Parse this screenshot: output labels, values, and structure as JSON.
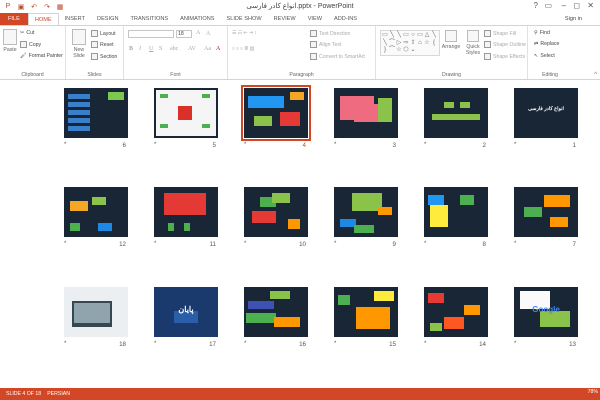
{
  "app": {
    "title": "انواع کادر فارسی.pptx - PowerPoint"
  },
  "quick_access": [
    "save-icon",
    "undo-icon",
    "redo-icon",
    "slideshow-icon"
  ],
  "window_controls": [
    "?",
    "▭",
    "–",
    "◻",
    "✕"
  ],
  "tabs": [
    "FILE",
    "HOME",
    "INSERT",
    "DESIGN",
    "TRANSITIONS",
    "ANIMATIONS",
    "SLIDE SHOW",
    "REVIEW",
    "VIEW",
    "ADD-INS"
  ],
  "active_tab": "HOME",
  "signin": "Sign in",
  "ribbon": {
    "clipboard": {
      "label": "Clipboard",
      "paste": "Paste",
      "cut": "Cut",
      "copy": "Copy",
      "format_painter": "Format Painter"
    },
    "slides": {
      "label": "Slides",
      "new_slide": "New Slide",
      "layout": "Layout",
      "reset": "Reset",
      "section": "Section"
    },
    "font": {
      "label": "Font",
      "size": "18"
    },
    "paragraph": {
      "label": "Paragraph",
      "text_direction": "Text Direction",
      "align_text": "Align Text",
      "convert": "Convert to SmartArt"
    },
    "drawing": {
      "label": "Drawing",
      "arrange": "Arrange",
      "quick_styles": "Quick Styles",
      "shape_fill": "Shape Fill",
      "shape_outline": "Shape Outline",
      "shape_effects": "Shape Effects"
    },
    "editing": {
      "label": "Editing",
      "find": "Find",
      "replace": "Replace",
      "select": "Select"
    }
  },
  "slides": [
    {
      "num": "6"
    },
    {
      "num": "5"
    },
    {
      "num": "4",
      "selected": true
    },
    {
      "num": "3"
    },
    {
      "num": "2"
    },
    {
      "num": "1",
      "text": "انواع کادر فارسی"
    },
    {
      "num": "12"
    },
    {
      "num": "11"
    },
    {
      "num": "10"
    },
    {
      "num": "9"
    },
    {
      "num": "8"
    },
    {
      "num": "7"
    },
    {
      "num": "18"
    },
    {
      "num": "17",
      "text": "پایان"
    },
    {
      "num": "16"
    },
    {
      "num": "15"
    },
    {
      "num": "14"
    },
    {
      "num": "13",
      "text": "Google"
    }
  ],
  "status": {
    "slide": "SLIDE 4 OF 18",
    "language": "PERSIAN",
    "zoom": "78%"
  },
  "colors": {
    "accent": "#d24726",
    "slide_bg": "#182636"
  }
}
